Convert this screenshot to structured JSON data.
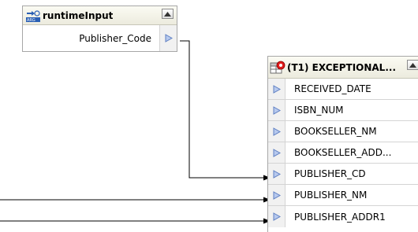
{
  "runtime_input": {
    "title": "runtimeInput",
    "icon": "runtime-input-arg-icon",
    "fields": [
      {
        "label": "Publisher_Code"
      }
    ]
  },
  "exceptional_table": {
    "title": "(T1) EXCEPTIONAL...",
    "icon": "database-table-icon",
    "fields": [
      {
        "label": "RECEIVED_DATE"
      },
      {
        "label": "ISBN_NUM"
      },
      {
        "label": "BOOKSELLER_NM"
      },
      {
        "label": "BOOKSELLER_ADD..."
      },
      {
        "label": "PUBLISHER_CD"
      },
      {
        "label": "PUBLISHER_NM"
      },
      {
        "label": "PUBLISHER_ADDR1"
      }
    ]
  },
  "colors": {
    "port_arrow": "#5e7fc2",
    "connector": "#000000"
  }
}
